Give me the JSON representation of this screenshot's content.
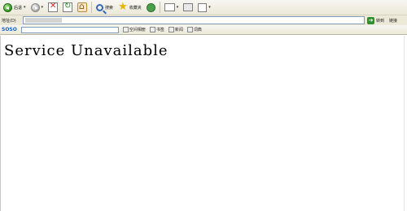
{
  "toolbar": {
    "back_label": "后退",
    "search_label": "搜索",
    "favorites_label": "收藏夹"
  },
  "address_bar": {
    "label": "地址(D)",
    "go_label": "转到",
    "links_label": "链接"
  },
  "soso_toolbar": {
    "logo": "SOSO",
    "item1": "空间相册",
    "item2": "书签",
    "item3": "新闻",
    "item4": "词典"
  },
  "content": {
    "error_title": "Service Unavailable"
  }
}
